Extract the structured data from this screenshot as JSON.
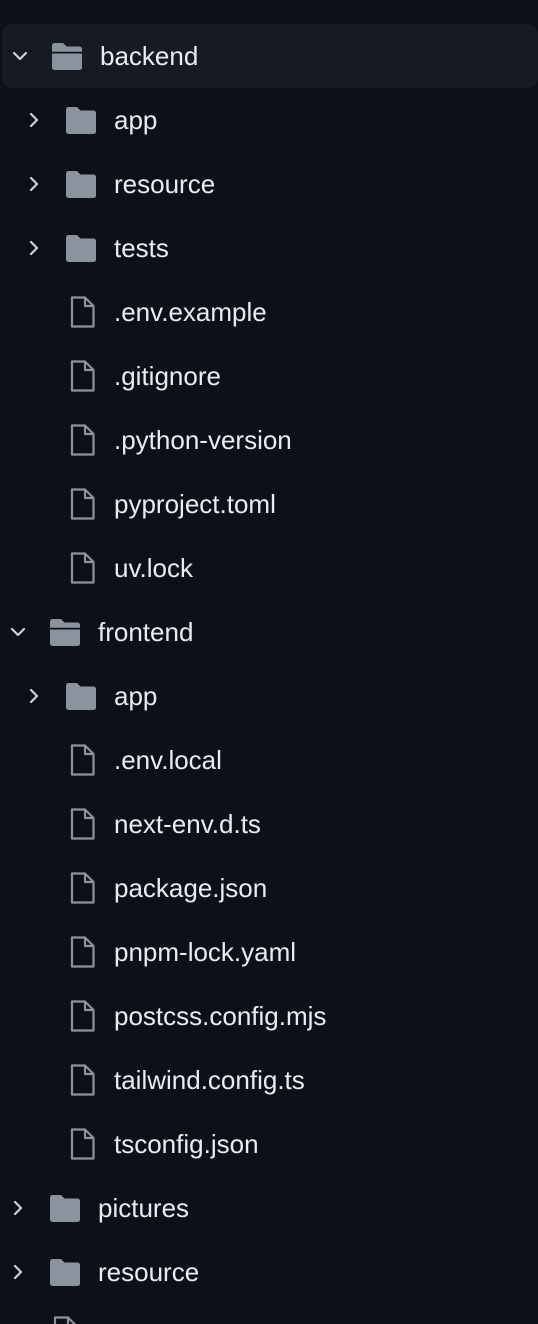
{
  "tree": [
    {
      "label": "backend",
      "type": "folder",
      "depth": 0,
      "expanded": true,
      "selected": true
    },
    {
      "label": "app",
      "type": "folder",
      "depth": 1,
      "expanded": false
    },
    {
      "label": "resource",
      "type": "folder",
      "depth": 1,
      "expanded": false
    },
    {
      "label": "tests",
      "type": "folder",
      "depth": 1,
      "expanded": false
    },
    {
      "label": ".env.example",
      "type": "file",
      "depth": 1
    },
    {
      "label": ".gitignore",
      "type": "file",
      "depth": 1
    },
    {
      "label": ".python-version",
      "type": "file",
      "depth": 1
    },
    {
      "label": "pyproject.toml",
      "type": "file",
      "depth": 1
    },
    {
      "label": "uv.lock",
      "type": "file",
      "depth": 1
    },
    {
      "label": "frontend",
      "type": "folder",
      "depth": 0,
      "expanded": true
    },
    {
      "label": "app",
      "type": "folder",
      "depth": 1,
      "expanded": false
    },
    {
      "label": ".env.local",
      "type": "file",
      "depth": 1
    },
    {
      "label": "next-env.d.ts",
      "type": "file",
      "depth": 1
    },
    {
      "label": "package.json",
      "type": "file",
      "depth": 1
    },
    {
      "label": "pnpm-lock.yaml",
      "type": "file",
      "depth": 1
    },
    {
      "label": "postcss.config.mjs",
      "type": "file",
      "depth": 1
    },
    {
      "label": "tailwind.config.ts",
      "type": "file",
      "depth": 1
    },
    {
      "label": "tsconfig.json",
      "type": "file",
      "depth": 1
    },
    {
      "label": "pictures",
      "type": "folder",
      "depth": 0,
      "expanded": false
    },
    {
      "label": "resource",
      "type": "folder",
      "depth": 0,
      "expanded": false
    }
  ],
  "colors": {
    "background": "#0d1117",
    "selected_row": "#161b22",
    "text": "#e6edf3",
    "icon": "#8b949e"
  }
}
